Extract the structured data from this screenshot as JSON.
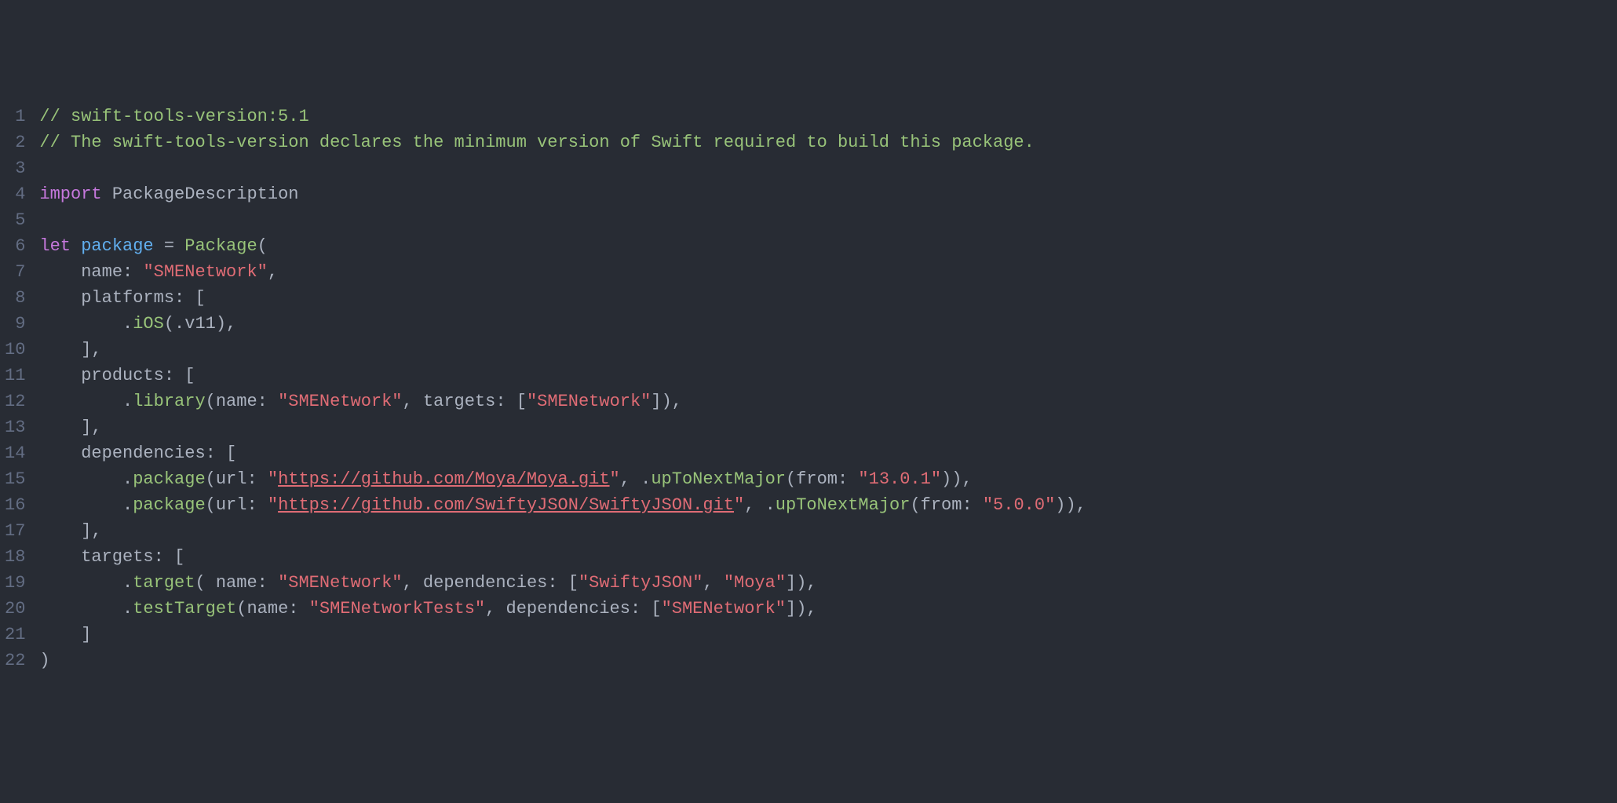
{
  "lines": [
    [
      {
        "t": "comment",
        "v": "// swift-tools-version:5.1"
      }
    ],
    [
      {
        "t": "comment",
        "v": "// The swift-tools-version declares the minimum version of Swift required to build this package."
      }
    ],
    [],
    [
      {
        "t": "keyword",
        "v": "import"
      },
      {
        "t": "punc",
        "v": " "
      },
      {
        "t": "ident",
        "v": "PackageDescription"
      }
    ],
    [],
    [
      {
        "t": "keyword",
        "v": "let"
      },
      {
        "t": "punc",
        "v": " "
      },
      {
        "t": "type",
        "v": "package"
      },
      {
        "t": "punc",
        "v": " "
      },
      {
        "t": "op",
        "v": "="
      },
      {
        "t": "punc",
        "v": " "
      },
      {
        "t": "func",
        "v": "Package"
      },
      {
        "t": "punc",
        "v": "("
      }
    ],
    [
      {
        "t": "punc",
        "v": "    "
      },
      {
        "t": "label",
        "v": "name"
      },
      {
        "t": "punc",
        "v": ": "
      },
      {
        "t": "string",
        "v": "\"SMENetwork\""
      },
      {
        "t": "punc",
        "v": ","
      }
    ],
    [
      {
        "t": "punc",
        "v": "    "
      },
      {
        "t": "label",
        "v": "platforms"
      },
      {
        "t": "punc",
        "v": ": ["
      }
    ],
    [
      {
        "t": "punc",
        "v": "        ."
      },
      {
        "t": "func",
        "v": "iOS"
      },
      {
        "t": "punc",
        "v": "(."
      },
      {
        "t": "ident",
        "v": "v11"
      },
      {
        "t": "punc",
        "v": "),"
      }
    ],
    [
      {
        "t": "punc",
        "v": "    ],"
      }
    ],
    [
      {
        "t": "punc",
        "v": "    "
      },
      {
        "t": "label",
        "v": "products"
      },
      {
        "t": "punc",
        "v": ": ["
      }
    ],
    [
      {
        "t": "punc",
        "v": "        ."
      },
      {
        "t": "func",
        "v": "library"
      },
      {
        "t": "punc",
        "v": "("
      },
      {
        "t": "label",
        "v": "name"
      },
      {
        "t": "punc",
        "v": ": "
      },
      {
        "t": "string",
        "v": "\"SMENetwork\""
      },
      {
        "t": "punc",
        "v": ", "
      },
      {
        "t": "label",
        "v": "targets"
      },
      {
        "t": "punc",
        "v": ": ["
      },
      {
        "t": "string",
        "v": "\"SMENetwork\""
      },
      {
        "t": "punc",
        "v": "]),"
      }
    ],
    [
      {
        "t": "punc",
        "v": "    ],"
      }
    ],
    [
      {
        "t": "punc",
        "v": "    "
      },
      {
        "t": "label",
        "v": "dependencies"
      },
      {
        "t": "punc",
        "v": ": ["
      }
    ],
    [
      {
        "t": "punc",
        "v": "        ."
      },
      {
        "t": "func",
        "v": "package"
      },
      {
        "t": "punc",
        "v": "("
      },
      {
        "t": "label",
        "v": "url"
      },
      {
        "t": "punc",
        "v": ": "
      },
      {
        "t": "string",
        "v": "\""
      },
      {
        "t": "stringurl",
        "v": "https://github.com/Moya/Moya.git"
      },
      {
        "t": "string",
        "v": "\""
      },
      {
        "t": "punc",
        "v": ", ."
      },
      {
        "t": "func",
        "v": "upToNextMajor"
      },
      {
        "t": "punc",
        "v": "("
      },
      {
        "t": "label",
        "v": "from"
      },
      {
        "t": "punc",
        "v": ": "
      },
      {
        "t": "string",
        "v": "\"13.0.1\""
      },
      {
        "t": "punc",
        "v": ")),"
      }
    ],
    [
      {
        "t": "punc",
        "v": "        ."
      },
      {
        "t": "func",
        "v": "package"
      },
      {
        "t": "punc",
        "v": "("
      },
      {
        "t": "label",
        "v": "url"
      },
      {
        "t": "punc",
        "v": ": "
      },
      {
        "t": "string",
        "v": "\""
      },
      {
        "t": "stringurl",
        "v": "https://github.com/SwiftyJSON/SwiftyJSON.git"
      },
      {
        "t": "string",
        "v": "\""
      },
      {
        "t": "punc",
        "v": ", ."
      },
      {
        "t": "func",
        "v": "upToNextMajor"
      },
      {
        "t": "punc",
        "v": "("
      },
      {
        "t": "label",
        "v": "from"
      },
      {
        "t": "punc",
        "v": ": "
      },
      {
        "t": "string",
        "v": "\"5.0.0\""
      },
      {
        "t": "punc",
        "v": ")),"
      }
    ],
    [
      {
        "t": "punc",
        "v": "    ],"
      }
    ],
    [
      {
        "t": "punc",
        "v": "    "
      },
      {
        "t": "label",
        "v": "targets"
      },
      {
        "t": "punc",
        "v": ": ["
      }
    ],
    [
      {
        "t": "punc",
        "v": "        ."
      },
      {
        "t": "func",
        "v": "target"
      },
      {
        "t": "punc",
        "v": "( "
      },
      {
        "t": "label",
        "v": "name"
      },
      {
        "t": "punc",
        "v": ": "
      },
      {
        "t": "string",
        "v": "\"SMENetwork\""
      },
      {
        "t": "punc",
        "v": ", "
      },
      {
        "t": "label",
        "v": "dependencies"
      },
      {
        "t": "punc",
        "v": ": ["
      },
      {
        "t": "string",
        "v": "\"SwiftyJSON\""
      },
      {
        "t": "punc",
        "v": ", "
      },
      {
        "t": "string",
        "v": "\"Moya\""
      },
      {
        "t": "punc",
        "v": "]),"
      }
    ],
    [
      {
        "t": "punc",
        "v": "        ."
      },
      {
        "t": "func",
        "v": "testTarget"
      },
      {
        "t": "punc",
        "v": "("
      },
      {
        "t": "label",
        "v": "name"
      },
      {
        "t": "punc",
        "v": ": "
      },
      {
        "t": "string",
        "v": "\"SMENetworkTests\""
      },
      {
        "t": "punc",
        "v": ", "
      },
      {
        "t": "label",
        "v": "dependencies"
      },
      {
        "t": "punc",
        "v": ": ["
      },
      {
        "t": "string",
        "v": "\"SMENetwork\""
      },
      {
        "t": "punc",
        "v": "]),"
      }
    ],
    [
      {
        "t": "punc",
        "v": "    ]"
      }
    ],
    [
      {
        "t": "punc",
        "v": ")"
      }
    ]
  ]
}
